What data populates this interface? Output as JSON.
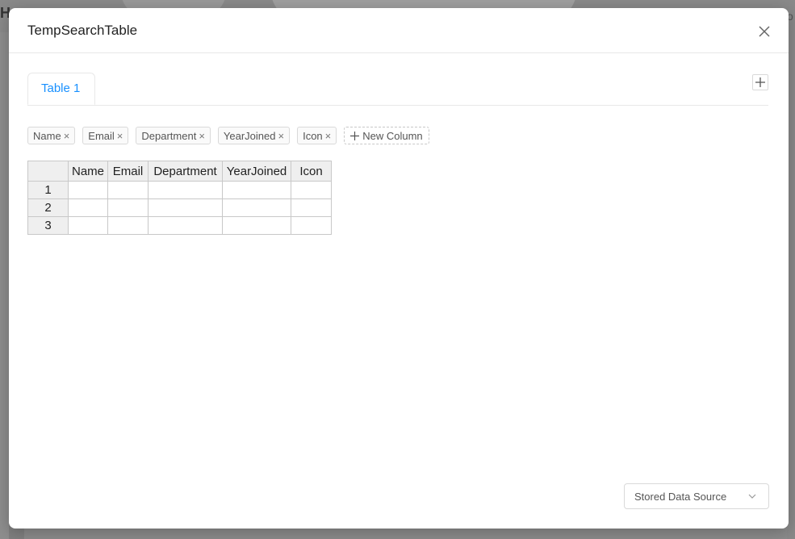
{
  "background": {
    "logo_glyph": "H",
    "right_glyph": "o"
  },
  "modal": {
    "title": "TempSearchTable"
  },
  "tabs": [
    {
      "label": "Table 1"
    }
  ],
  "column_tags": [
    {
      "label": "Name"
    },
    {
      "label": "Email"
    },
    {
      "label": "Department"
    },
    {
      "label": "YearJoined"
    },
    {
      "label": "Icon"
    }
  ],
  "new_column_label": "New Column",
  "table": {
    "headers": [
      "",
      "Name",
      "Email",
      "Department",
      "YearJoined",
      "Icon"
    ],
    "rows": [
      {
        "num": "1",
        "cells": [
          "",
          "",
          "",
          "",
          ""
        ]
      },
      {
        "num": "2",
        "cells": [
          "",
          "",
          "",
          "",
          ""
        ]
      },
      {
        "num": "3",
        "cells": [
          "",
          "",
          "",
          "",
          ""
        ]
      }
    ]
  },
  "footer": {
    "data_source_label": "Stored Data Source"
  },
  "colors": {
    "accent": "#1890ff",
    "border": "#d9d9d9",
    "header_bg": "#efefef"
  },
  "icons": {
    "close": "close-icon",
    "add_tab": "plus-icon",
    "tag_remove": "close-icon",
    "new_column": "plus-icon",
    "select": "chevron-down-icon"
  }
}
